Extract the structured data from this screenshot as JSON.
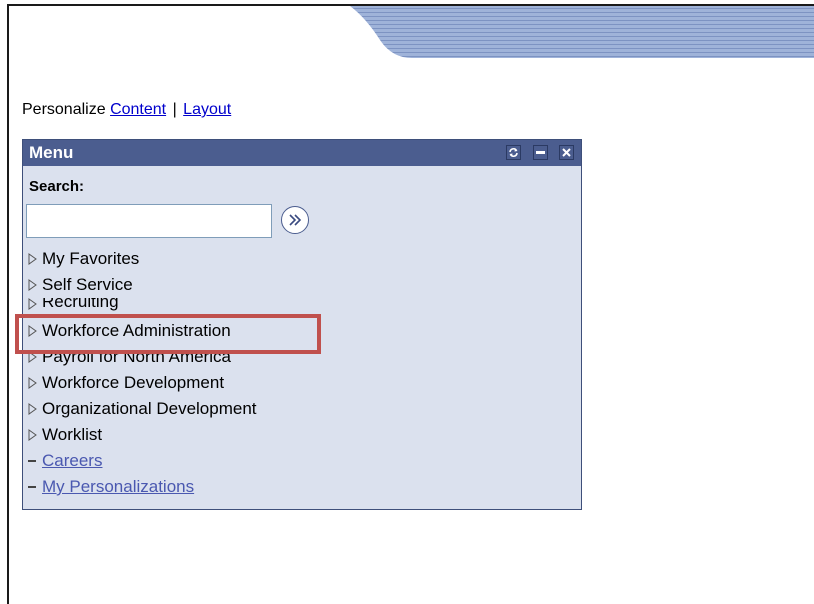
{
  "personalize": {
    "prefix": "Personalize",
    "content_link": "Content",
    "separator": "|",
    "layout_link": "Layout"
  },
  "menu": {
    "title": "Menu",
    "header_buttons": [
      "refresh-icon",
      "minimize-icon",
      "close-icon"
    ],
    "search_label": "Search:",
    "search_value": "",
    "go_button_icon": "double-chevron-right-icon",
    "items": [
      {
        "label": "My Favorites",
        "type": "folder"
      },
      {
        "label": "Self Service",
        "type": "folder"
      },
      {
        "label": "Recruiting",
        "type": "folder"
      },
      {
        "label": "Workforce Administration",
        "type": "folder",
        "highlighted": true
      },
      {
        "label": "Payroll for North America",
        "type": "folder"
      },
      {
        "label": "Workforce Development",
        "type": "folder"
      },
      {
        "label": "Organizational Development",
        "type": "folder"
      },
      {
        "label": "Worklist",
        "type": "folder"
      },
      {
        "label": "Careers",
        "type": "link"
      },
      {
        "label": "My Personalizations",
        "type": "link"
      }
    ]
  },
  "colors": {
    "menu_header": "#4b5d8f",
    "menu_body": "#dbe1ee",
    "highlight_border": "#c0504d",
    "link": "#0000cc",
    "menu_link": "#4a58b0"
  }
}
